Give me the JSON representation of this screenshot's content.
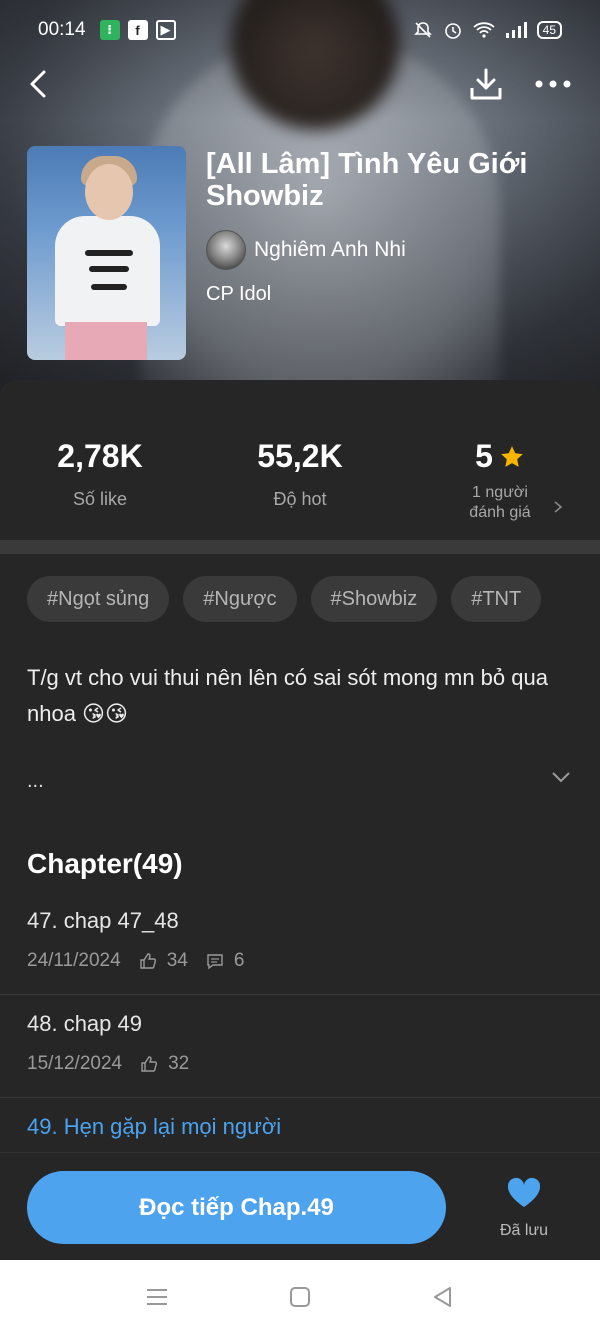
{
  "status_bar": {
    "time": "00:14",
    "battery": "45"
  },
  "story": {
    "title": "[All Lâm] Tình Yêu Giới Showbiz",
    "author": "Nghiêm Anh Nhi",
    "category": "CP Idol"
  },
  "stats": {
    "likes_value": "2,78K",
    "likes_label": "Số like",
    "hot_value": "55,2K",
    "hot_label": "Độ hot",
    "rating_value": "5",
    "rating_label_line1": "1 người",
    "rating_label_line2": "đánh giá"
  },
  "tags": [
    "#Ngọt sủng",
    "#Ngược",
    "#Showbiz",
    "#TNT"
  ],
  "description": "T/g vt cho vui thui nên lên có sai sót mong mn bỏ qua nhoa 😘😘",
  "description_more": "...",
  "chapters_heading": "Chapter(49)",
  "chapters": [
    {
      "name": "47. chap 47_48",
      "date": "24/11/2024",
      "likes": "34",
      "comments": "6"
    },
    {
      "name": "48. chap 49",
      "date": "15/12/2024",
      "likes": "32"
    },
    {
      "name": "49. Hẹn gặp lại mọi người"
    }
  ],
  "actions": {
    "read_button": "Đọc tiếp Chap.49",
    "saved_label": "Đã lưu"
  },
  "colors": {
    "accent": "#4da3ee",
    "star": "#f7b500",
    "background": "#262626"
  }
}
